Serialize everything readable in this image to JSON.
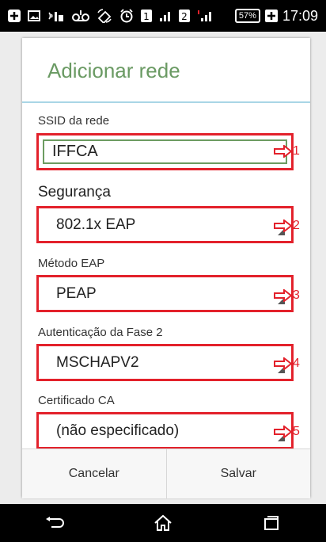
{
  "status_bar": {
    "time": "17:09",
    "battery": "57%",
    "sim1": "1",
    "sim2": "2",
    "icons": [
      "plus-box-icon",
      "image-icon",
      "signal-icon",
      "voicemail-icon",
      "rotation-icon",
      "alarm-icon",
      "sim1-icon",
      "signal-bars-icon",
      "sim2-icon",
      "signal-bars-icon",
      "battery-icon",
      "charging-icon"
    ]
  },
  "dialog": {
    "title": "Adicionar rede",
    "ssid_label": "SSID da rede",
    "ssid_value": "IFFCA",
    "security_label": "Segurança",
    "security_value": "802.1x EAP",
    "eap_label": "Método EAP",
    "eap_value": "PEAP",
    "phase2_label": "Autenticação da Fase 2",
    "phase2_value": "MSCHAPV2",
    "ca_label": "Certificado CA",
    "ca_value": "(não especificado)",
    "cancel_label": "Cancelar",
    "save_label": "Salvar"
  },
  "callouts": [
    "1",
    "2",
    "3",
    "4",
    "5"
  ],
  "colors": {
    "title_green": "#6a9a63",
    "divider_blue": "#a9d6e6",
    "annotation_red": "#e3212b"
  },
  "nav_bar": {
    "icons": [
      "back-icon",
      "home-icon",
      "recent-apps-icon"
    ]
  }
}
